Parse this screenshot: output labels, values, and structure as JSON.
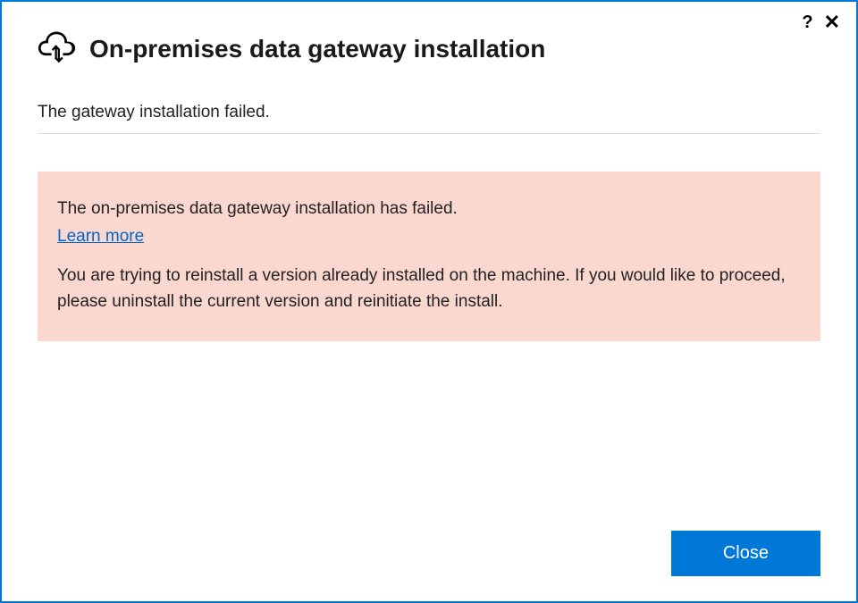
{
  "titlebar": {
    "help_glyph": "?",
    "close_glyph": "✕"
  },
  "header": {
    "title": "On-premises data gateway installation"
  },
  "status": {
    "text": "The gateway installation failed."
  },
  "error": {
    "title": "The on-premises data gateway installation has failed.",
    "learn_more_label": "Learn more",
    "detail": "You are trying to reinstall a version already installed on the machine. If you would like to proceed, please uninstall the current version and reinitiate the install."
  },
  "footer": {
    "close_label": "Close"
  }
}
